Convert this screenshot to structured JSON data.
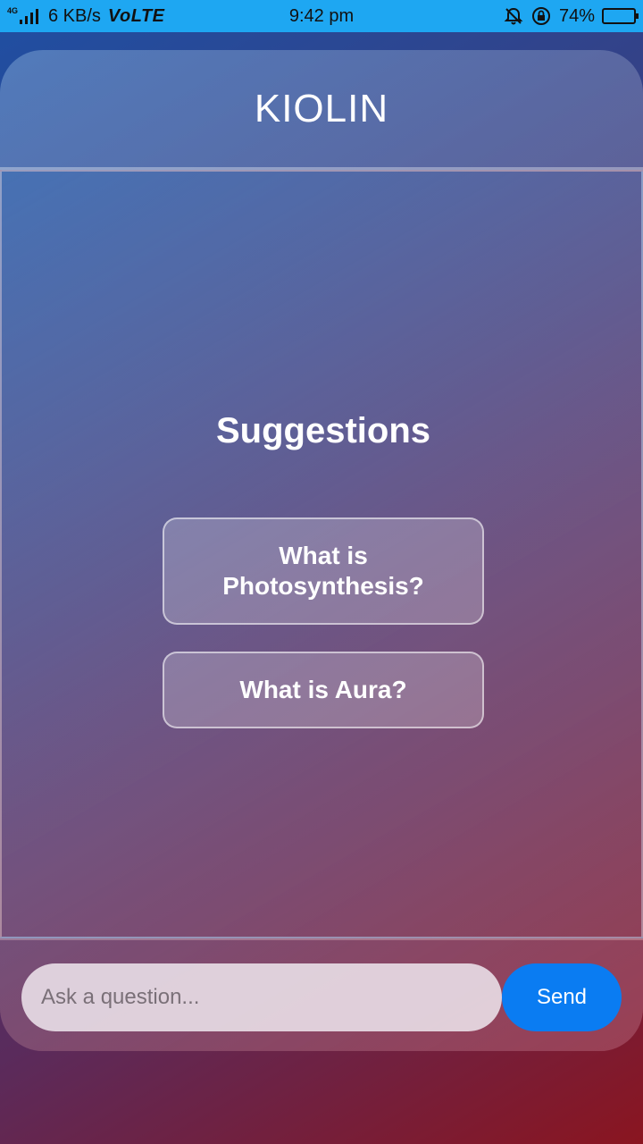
{
  "status_bar": {
    "network": "4G",
    "speed": "6 KB/s",
    "volte": "VoLTE",
    "time": "9:42 pm",
    "battery_percent": "74%",
    "battery_level": 0.74,
    "icons": [
      "signal-icon",
      "bell-off-icon",
      "rotation-lock-icon",
      "battery-icon"
    ]
  },
  "app": {
    "title": "KIOLIN"
  },
  "chat": {
    "suggestions_title": "Suggestions",
    "suggestions": [
      "What is Photosynthesis?",
      "What is Aura?"
    ]
  },
  "composer": {
    "placeholder": "Ask a question...",
    "send_label": "Send"
  },
  "colors": {
    "status_bar": "#1ea7f2",
    "send_button": "#0a7cf2"
  }
}
